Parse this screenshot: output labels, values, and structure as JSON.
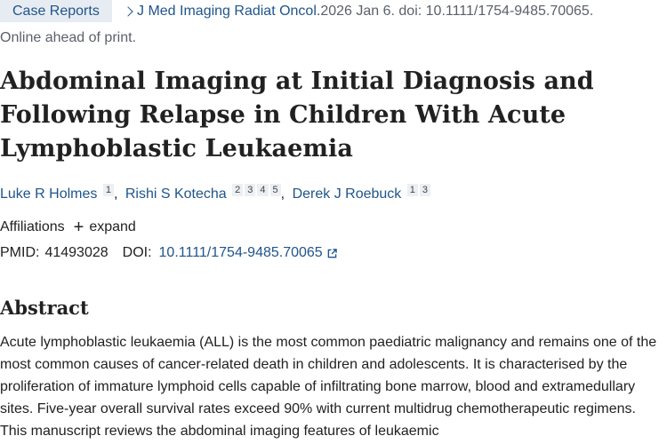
{
  "header": {
    "badge": "Case Reports",
    "journal": "J Med Imaging Radiat Oncol.",
    "citation": " 2026 Jan 6. doi: 10.1111/1754-9485.70065.",
    "status": "Online ahead of print."
  },
  "article": {
    "title": "Abdominal Imaging at Initial Diagnosis and Following Relapse in Children With Acute Lymphoblastic Leukaemia"
  },
  "authors": [
    {
      "name": "Luke R Holmes",
      "affils": [
        "1"
      ]
    },
    {
      "name": "Rishi S Kotecha",
      "affils": [
        "2",
        "3",
        "4",
        "5"
      ]
    },
    {
      "name": "Derek J Roebuck",
      "affils": [
        "1",
        "3"
      ]
    }
  ],
  "affiliations": {
    "label": "Affiliations",
    "expand_label": "expand"
  },
  "ids": {
    "pmid_label": "PMID:",
    "pmid": "41493028",
    "doi_label": "DOI:",
    "doi": "10.1111/1754-9485.70065"
  },
  "abstract": {
    "heading": "Abstract",
    "text": "Acute lymphoblastic leukaemia (ALL) is the most common paediatric malignancy and remains one of the most common causes of cancer-related death in children and adolescents. It is characterised by the proliferation of immature lymphoid cells capable of infiltrating bone marrow, blood and extramedullary sites. Five-year overall survival rates exceed 90% with current multidrug chemotherapeutic regimens. This manuscript reviews the abdominal imaging features of leukaemic"
  },
  "icons": {
    "breadcrumb": "chevron-right-icon",
    "doi_link": "external-link-icon",
    "expand": "plus-icon"
  },
  "colors": {
    "link": "#20558a",
    "badge_bg": "#e7ecf2",
    "text": "#212121",
    "muted": "#5b616b"
  }
}
